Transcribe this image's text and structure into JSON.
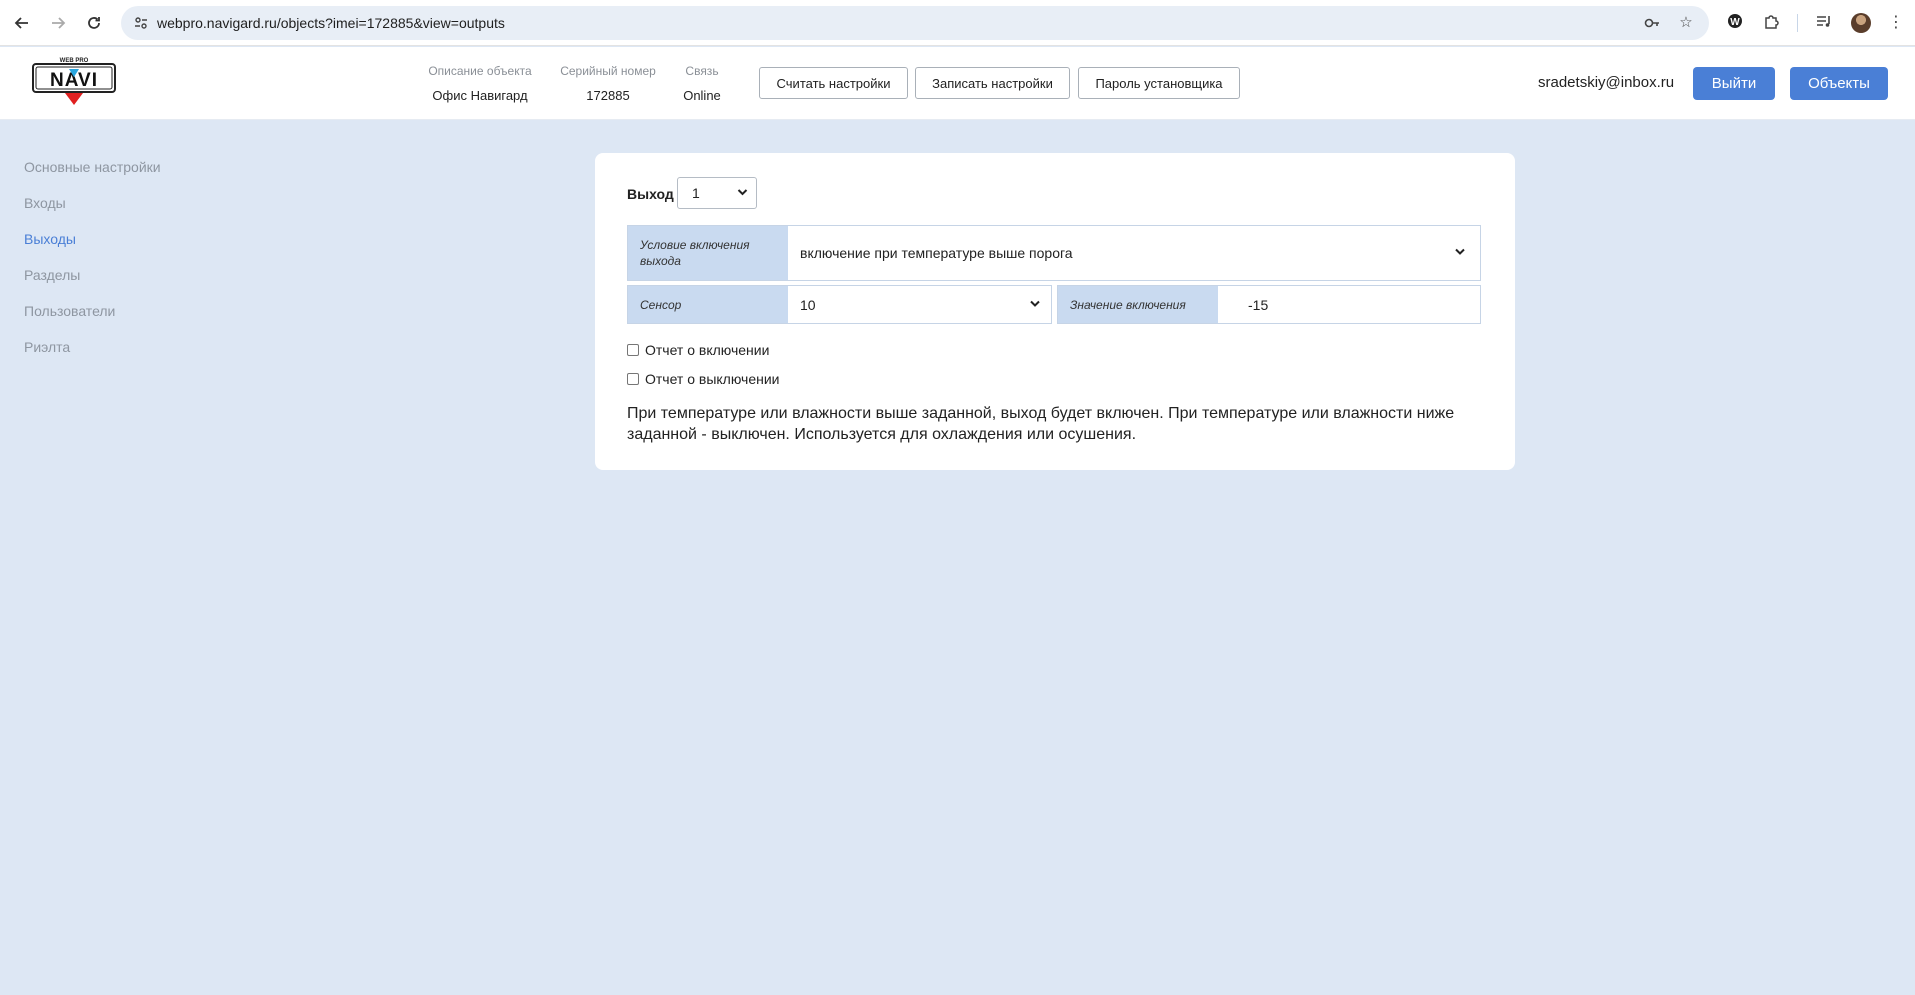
{
  "browser": {
    "url": "webpro.navigard.ru/objects?imei=172885&view=outputs"
  },
  "header": {
    "logo_text": "NAVI",
    "logo_small_text": "WEB PRO",
    "meta": [
      {
        "label": "Описание объекта",
        "value": "Офис Навигард"
      },
      {
        "label": "Серийный номер",
        "value": "172885"
      },
      {
        "label": "Связь",
        "value": "Online"
      }
    ],
    "buttons": {
      "read": "Считать настройки",
      "write": "Записать настройки",
      "password": "Пароль установщика"
    },
    "user_email": "sradetskiy@inbox.ru",
    "logout": "Выйти",
    "objects": "Объекты"
  },
  "sidebar": {
    "items": [
      {
        "label": "Основные настройки",
        "active": false
      },
      {
        "label": "Входы",
        "active": false
      },
      {
        "label": "Выходы",
        "active": true
      },
      {
        "label": "Разделы",
        "active": false
      },
      {
        "label": "Пользователи",
        "active": false
      },
      {
        "label": "Риэлта",
        "active": false
      }
    ]
  },
  "main": {
    "output_label": "Выход",
    "output_value": "1",
    "condition_label": "Условие включения выхода",
    "condition_value": "включение при температуре выше порога",
    "sensor_label": "Сенсор",
    "sensor_value": "10",
    "threshold_label": "Значение включения",
    "threshold_value": "-15",
    "report_on": "Отчет о включении",
    "report_off": "Отчет о выключении",
    "description": "При температуре или влажности выше заданной, выход будет включен. При температуре или влажности ниже заданной - выключен. Используется для охлаждения или осушения."
  },
  "colors": {
    "accent": "#4a7fd6",
    "page_bg": "#dde7f4",
    "label_bg": "#c9daf0"
  }
}
